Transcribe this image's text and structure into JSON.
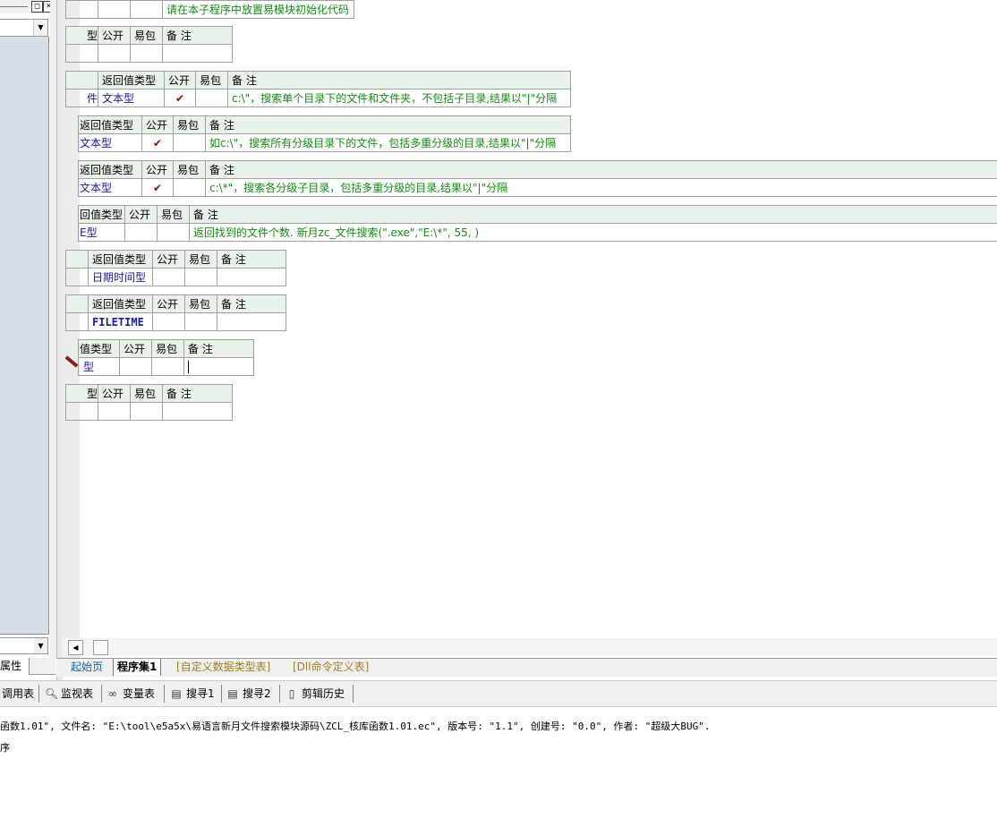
{
  "left_panel": {
    "close_glyph": "×",
    "max_glyph": "□",
    "property_tab": "属性"
  },
  "tables": {
    "t0_note": "请在本子程序中放置易模块初始化代码",
    "t1": {
      "h": [
        "型",
        "公开",
        "易包",
        "备 注"
      ]
    },
    "t2": {
      "h": [
        "返回值类型",
        "公开",
        "易包",
        "备 注"
      ],
      "row": [
        "件",
        "文本型",
        "✔",
        "",
        "c:\\\"，搜索单个目录下的文件和文件夹，不包括子目录,结果以\"|\"分隔"
      ]
    },
    "t3": {
      "h": [
        "返回值类型",
        "公开",
        "易包",
        "备 注"
      ],
      "row": [
        "文本型",
        "✔",
        "",
        "如c:\\\"，搜索所有分级目录下的文件，包括多重分级的目录,结果以\"|\"分隔"
      ]
    },
    "t4": {
      "h": [
        "返回值类型",
        "公开",
        "易包",
        "备 注"
      ],
      "row": [
        "文本型",
        "✔",
        "",
        "c:\\*\"，搜索各分级子目录，包括多重分级的目录,结果以\"|\"分隔"
      ]
    },
    "t5": {
      "h": [
        "回值类型",
        "公开",
        "易包",
        "备 注"
      ],
      "row": [
        "E型",
        "",
        "",
        "返回找到的文件个数. 新月zc_文件搜索(\".exe\",\"E:\\*\", 55, )"
      ]
    },
    "t6": {
      "h": [
        "返回值类型",
        "公开",
        "易包",
        "备 注"
      ],
      "row": [
        "日期时间型",
        "",
        "",
        ""
      ]
    },
    "t7": {
      "h": [
        "返回值类型",
        "公开",
        "易包",
        "备 注"
      ],
      "row": [
        "FILETIME",
        "",
        "",
        ""
      ]
    },
    "t8": {
      "h": [
        "值类型",
        "公开",
        "易包",
        "备 注"
      ],
      "row": [
        "型",
        "",
        "",
        ""
      ]
    },
    "t9": {
      "h": [
        "型",
        "公开",
        "易包",
        "备 注"
      ]
    }
  },
  "tabs": {
    "start": "起始页",
    "program_set": "程序集1",
    "custom_types": "[自定义数据类型表]",
    "dll_table": "[Dll命令定义表]"
  },
  "tools": {
    "call_table": "调用表",
    "watch_table": "监视表",
    "var_table": "变量表",
    "search1": "搜寻1",
    "search2": "搜寻2",
    "clip_history": "剪辑历史"
  },
  "output": {
    "line1": "函数1.01\", 文件名: \"E:\\tool\\e5a5x\\易语言新月文件搜索模块源码\\ZCL_核库函数1.01.ec\", 版本号: \"1.1\", 创建号: \"0.0\", 作者: \"超级大BUG\".",
    "line2": "序"
  }
}
